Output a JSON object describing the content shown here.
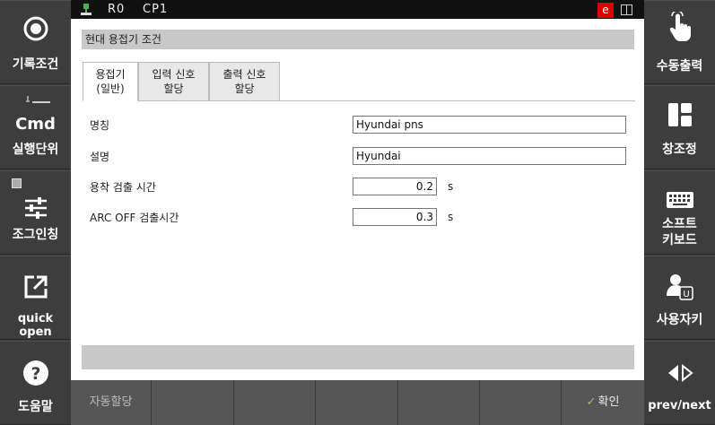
{
  "left_sidebar": [
    {
      "label": "기록조건",
      "icon": "record-circle-icon"
    },
    {
      "label": "실행단위",
      "icon_text": "Cmd",
      "icon": "cmd-step-icon"
    },
    {
      "label": "조그인칭",
      "icon": "jog-sliders-icon"
    },
    {
      "label": "quick open",
      "icon": "external-open-icon"
    },
    {
      "label": "도움말",
      "icon": "help-icon"
    }
  ],
  "right_sidebar": [
    {
      "label": "수동출력",
      "icon": "hand-pointer-icon"
    },
    {
      "label": "창조정",
      "icon": "window-layout-icon"
    },
    {
      "label": "소프트\n키보드",
      "icon": "keyboard-icon"
    },
    {
      "label": "사용자키",
      "icon": "user-key-icon"
    },
    {
      "label": "prev/next",
      "icon": "prev-next-icon"
    }
  ],
  "status": {
    "robot": "R0",
    "cp": "CP1",
    "badge": "e",
    "badge_color": "#e00000"
  },
  "panel_title": "현대 용접기 조건",
  "tabs": [
    {
      "label": "용접기\n(일반)",
      "active": true
    },
    {
      "label": "입력 신호\n할당",
      "active": false
    },
    {
      "label": "출력 신호\n할당",
      "active": false
    }
  ],
  "form": {
    "name_label": "명칭",
    "name_value": "Hyundai pns",
    "desc_label": "설명",
    "desc_value": "Hyundai",
    "stick_label": "용착 검출 시간",
    "stick_value": "0.2",
    "stick_unit": "s",
    "arcoff_label": "ARC OFF 검출시간",
    "arcoff_value": "0.3",
    "arcoff_unit": "s"
  },
  "softkeys": {
    "auto_assign": "자동할당",
    "ok": "확인"
  }
}
